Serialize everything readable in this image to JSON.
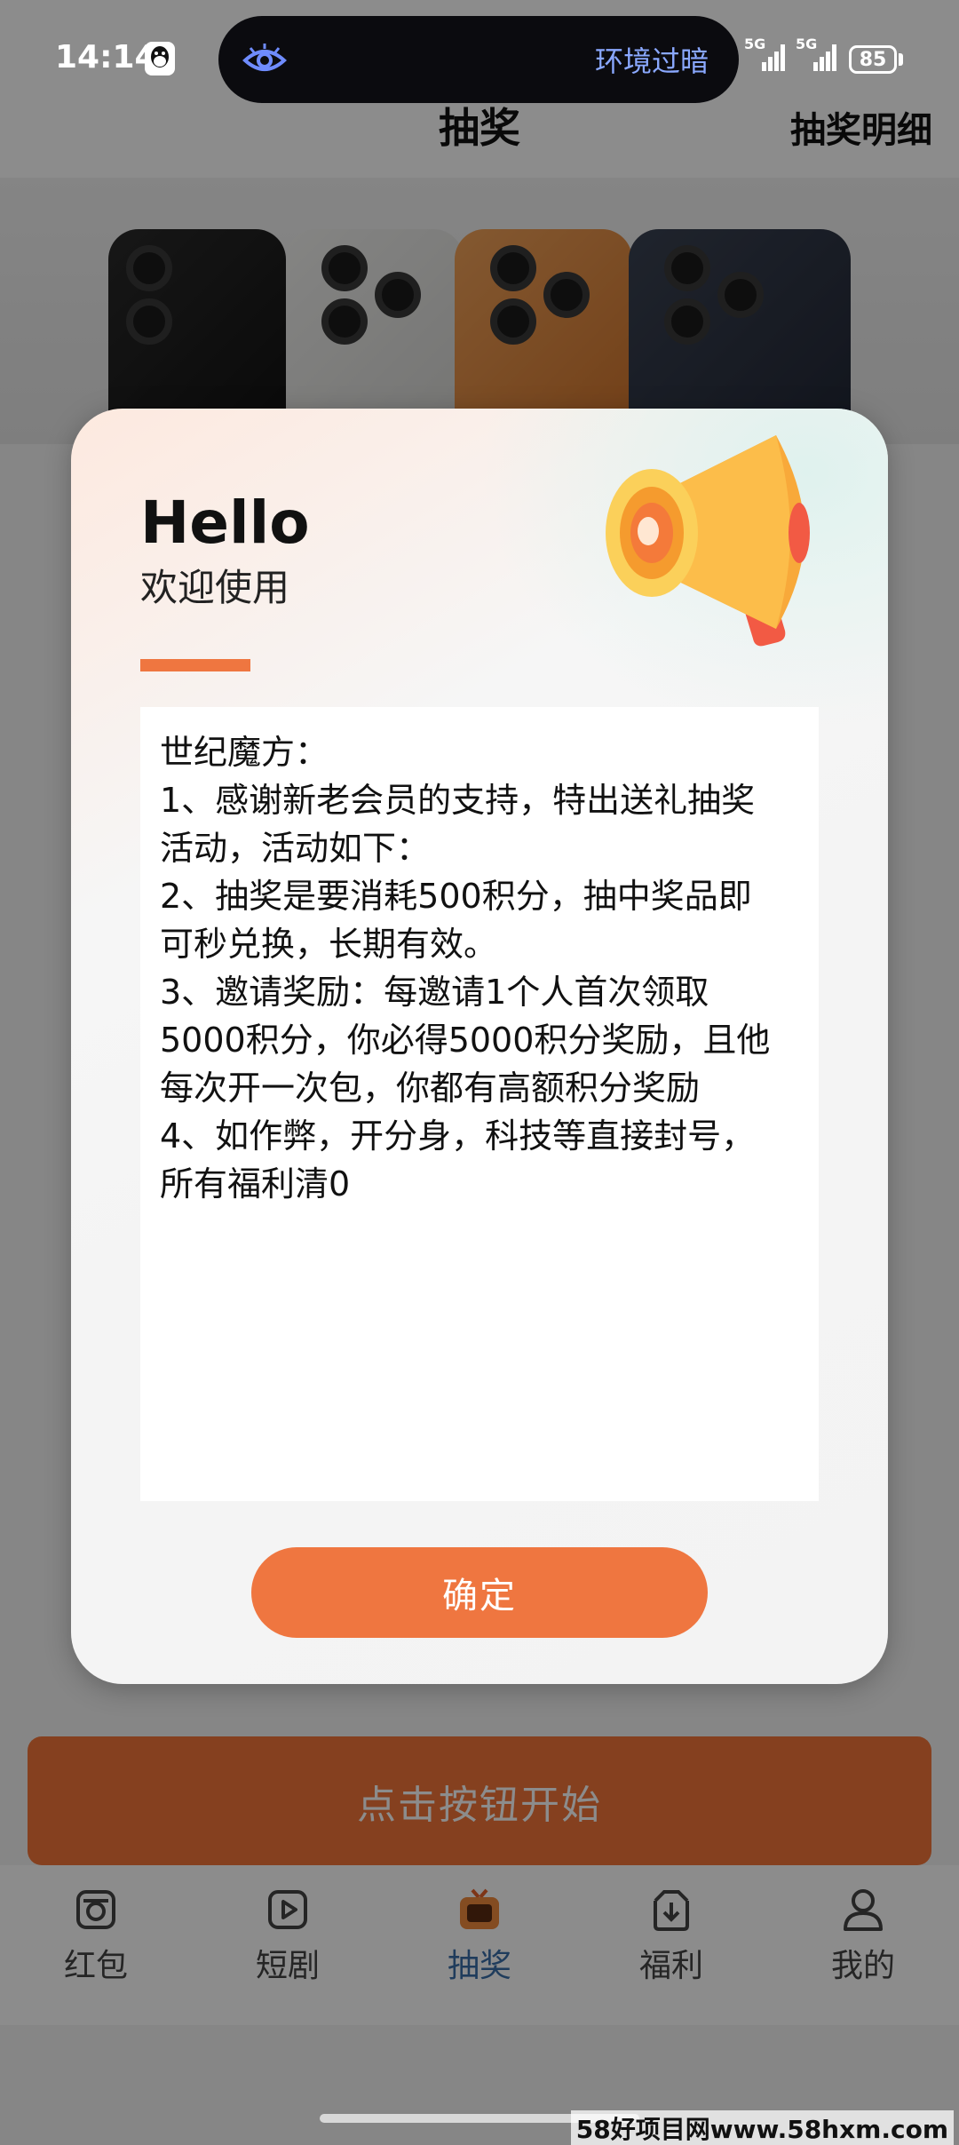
{
  "status_bar": {
    "time": "14:14",
    "island_text": "环境过暗",
    "signal_1": "5G",
    "signal_2": "5G",
    "battery": "85"
  },
  "header": {
    "title": "抽奖",
    "detail_link": "抽奖明细"
  },
  "modal": {
    "hello": "Hello",
    "welcome": "欢迎使用",
    "content_lines": [
      "世纪魔方：",
      "1、感谢新老会员的支持，特出送礼抽奖",
      "活动，活动如下：",
      "2、抽奖是要消耗500积分，抽中奖品即",
      "可秒兑换，长期有效。",
      "3、邀请奖励：每邀请1个人首次领取",
      "5000积分，你必得5000积分奖励，且他",
      "每次开一次包，你都有高额积分奖励",
      "4、如作弊，开分身，科技等直接封号，",
      "所有福利清0"
    ],
    "confirm_label": "确定"
  },
  "start_button": "点击按钮开始",
  "tabs": [
    {
      "label": "红包",
      "icon": "camera-icon",
      "active": false
    },
    {
      "label": "短剧",
      "icon": "play-icon",
      "active": false
    },
    {
      "label": "抽奖",
      "icon": "tv-icon",
      "active": true
    },
    {
      "label": "福利",
      "icon": "download-box-icon",
      "active": false
    },
    {
      "label": "我的",
      "icon": "user-icon",
      "active": false
    }
  ],
  "watermark": "58好项目网www.58hxm.com",
  "colors": {
    "accent": "#ef7640",
    "active_tab": "#3a6ea8",
    "island_text": "#8aa8ff"
  }
}
